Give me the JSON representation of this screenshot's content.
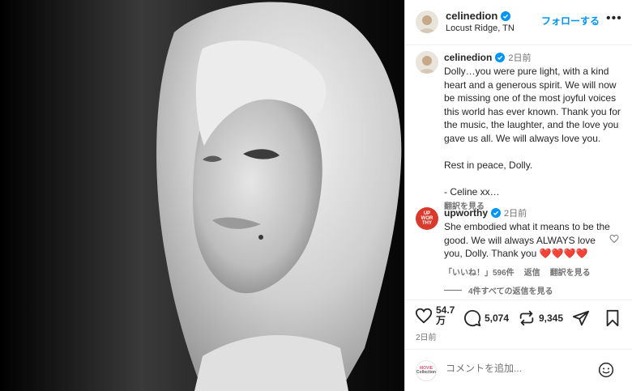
{
  "header": {
    "username": "celinedion",
    "location": "Locust Ridge, TN",
    "follow_label": "フォローする",
    "more_label": "•••"
  },
  "caption": {
    "username": "celinedion",
    "time": "2日前",
    "text": "Dolly…you were pure light, with a kind heart and a generous spirit.  We will now be missing one of the most joyful voices this world has ever known. Thank you for the music, the laughter, and the love you gave us all.  We will always love you.\n\nRest in peace, Dolly.\n\n- Celine xx…",
    "translate_label": "翻訳を見る"
  },
  "reply": {
    "avatar_text": [
      "UP",
      "WOR",
      "THY"
    ],
    "username": "upworthy",
    "time": "2日前",
    "text": "She embodied what it means to be the good. We will always ALWAYS love you, Dolly. Thank you ❤️❤️❤️❤️",
    "likes_label": "「いいね！」596件",
    "reply_label": "返信",
    "translate_label": "翻訳を見る",
    "view_replies_label": "4件すべての返信を見る"
  },
  "actions": {
    "likes_line1": "54.7",
    "likes_line2": "万",
    "comments_count": "5,074",
    "reposts_count": "9,345",
    "date": "2日前"
  },
  "comment_box": {
    "avatar_text": [
      "MOVIE",
      "Collection"
    ],
    "placeholder": "コメントを追加..."
  },
  "colors": {
    "accent": "#0095f6",
    "verified": "#0095f6",
    "upworthy_red": "#d93a2b",
    "muted": "#737373"
  },
  "icons": [
    "verified-badge-icon",
    "more-icon",
    "heart-icon",
    "comment-icon",
    "repost-icon",
    "share-icon",
    "bookmark-icon",
    "emoji-icon"
  ]
}
